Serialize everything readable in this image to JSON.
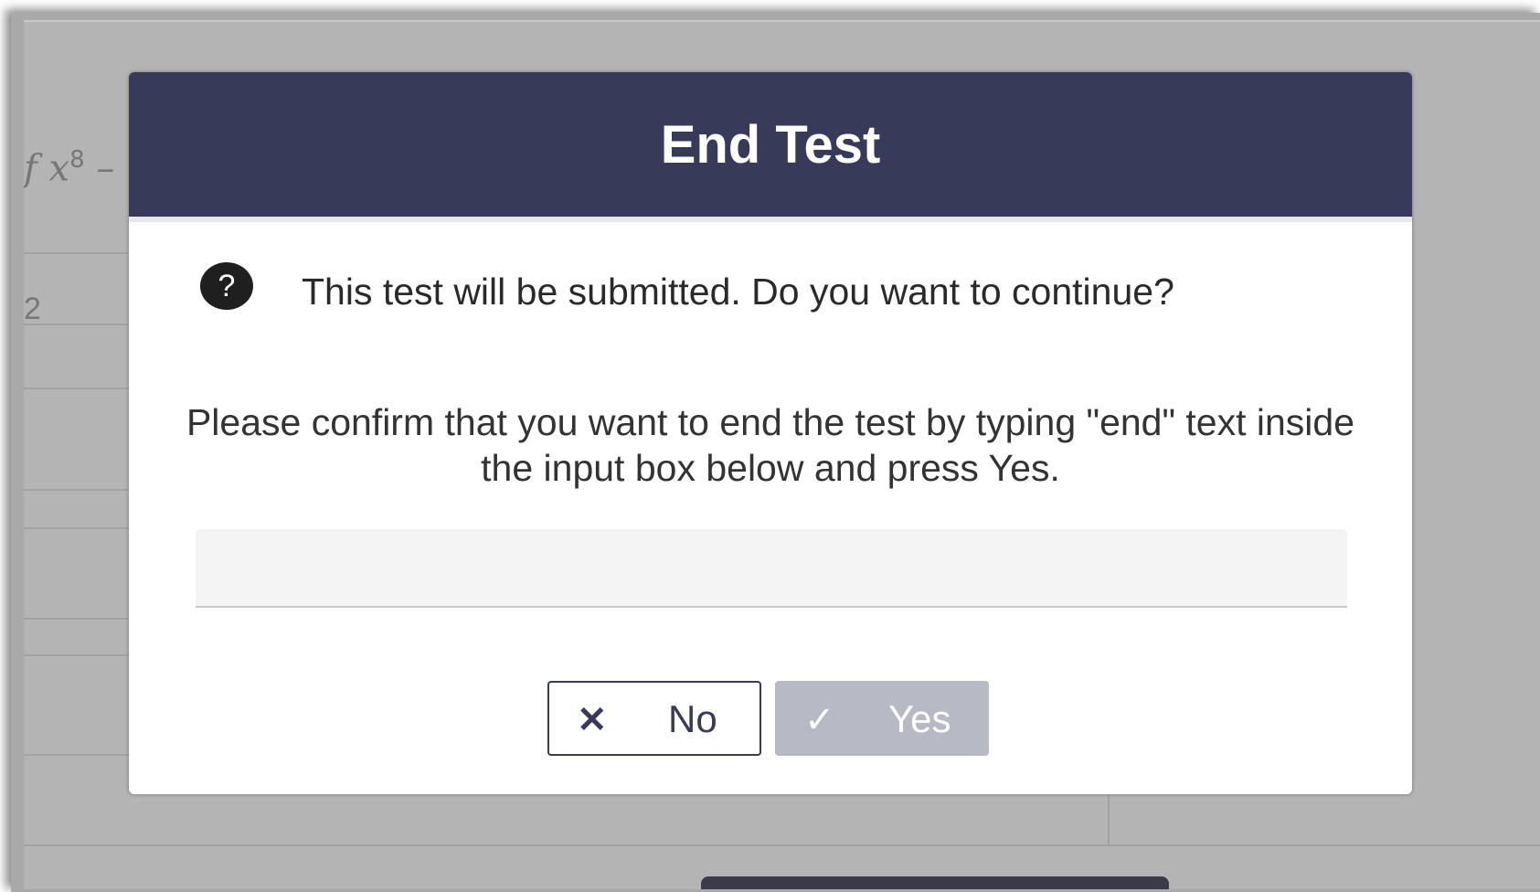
{
  "background": {
    "math_fragment": "f x",
    "math_superscript": "8",
    "math_operator": " –",
    "row_fragment": "2"
  },
  "dialog": {
    "title": "End Test",
    "question_icon": "question-circle-icon",
    "question_icon_glyph": "?",
    "question": "This test will be submitted. Do you want to continue?",
    "instruction": "Please confirm that you want to end the test by typing \"end\" text inside the input box below and press Yes.",
    "input": {
      "value": "",
      "placeholder": ""
    },
    "buttons": {
      "no": {
        "icon": "close-icon",
        "icon_glyph": "✕",
        "label": "No"
      },
      "yes": {
        "icon": "check-icon",
        "icon_glyph": "✓",
        "label": "Yes",
        "enabled": false
      }
    }
  },
  "colors": {
    "header": "#373a59",
    "overlay": "#b4b4b4",
    "yes_disabled": "#b7bac4"
  }
}
